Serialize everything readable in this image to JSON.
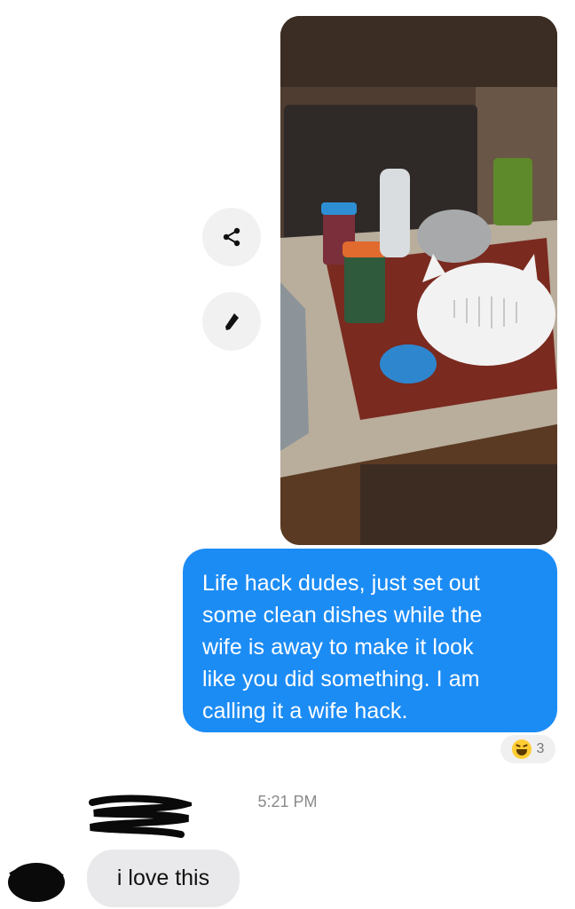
{
  "conversation": {
    "outgoing": {
      "photo_icon": "kitchen-photo",
      "message_text": "Life hack dudes, just set out\nsome clean dishes while the\nwife is away to make it look\nlike you did something.  I am\ncalling it a wife hack.",
      "reaction": {
        "emoji": "laughing-face",
        "count": "3"
      }
    },
    "timestamp": "5:21 PM",
    "incoming": {
      "message_text": "i love this"
    }
  },
  "actions": {
    "share_icon": "share-icon",
    "edit_icon": "pencil-icon"
  },
  "colors": {
    "outgoing_bubble": "#1c8cf5",
    "incoming_bubble": "#e9e9eb",
    "action_circle": "#f1f1f1",
    "timestamp_text": "#8a8a8a"
  }
}
